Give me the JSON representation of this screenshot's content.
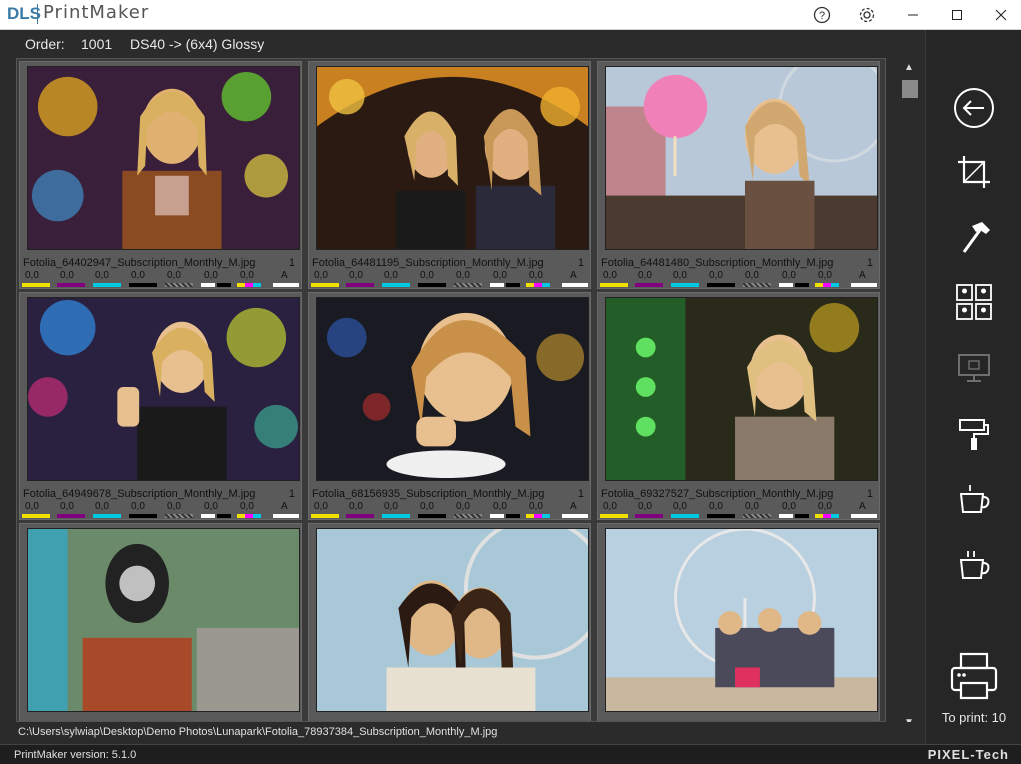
{
  "app": {
    "brand": "DLS",
    "name": "PrintMaker"
  },
  "window_controls": {
    "help_icon": "help-icon",
    "settings_icon": "gear-icon",
    "minimize_icon": "minimize-icon",
    "maximize_icon": "maximize-icon",
    "close_icon": "close-icon"
  },
  "order": {
    "label": "Order:",
    "number": "1001",
    "spec": "DS40 -> (6x4) Glossy"
  },
  "photos": [
    {
      "filename": "Fotolia_64402947_Subscription_Monthly_M.jpg",
      "qty": "1"
    },
    {
      "filename": "Fotolia_64481195_Subscription_Monthly_M.jpg",
      "qty": "1"
    },
    {
      "filename": "Fotolia_64481480_Subscription_Monthly_M.jpg",
      "qty": "1"
    },
    {
      "filename": "Fotolia_64949678_Subscription_Monthly_M.jpg",
      "qty": "1"
    },
    {
      "filename": "Fotolia_68156935_Subscription_Monthly_M.jpg",
      "qty": "1"
    },
    {
      "filename": "Fotolia_69327527_Subscription_Monthly_M.jpg",
      "qty": "1"
    }
  ],
  "correction_values": [
    "0,0",
    "0,0",
    "0,0",
    "0,0",
    "0,0",
    "0,0",
    "0,0",
    "0,0",
    "A"
  ],
  "correction_colors": [
    "#f0e000",
    "#800080",
    "#00c8e0",
    "#000000",
    "#888888",
    "#ffffff",
    "#ff00ff",
    "#ffffff"
  ],
  "scroll": {
    "up_icon": "scroll-up-arrow",
    "down_icon": "scroll-down-arrow"
  },
  "path": "C:\\Users\\sylwiap\\Desktop\\Demo Photos\\Lunapark\\Fotolia_78937384_Subscription_Monthly_M.jpg",
  "status": {
    "version": "PrintMaker version: 5.1.0",
    "brand": "PIXEL-Tech"
  },
  "sidebar": {
    "buttons": [
      "back-arrow-icon",
      "crop-icon",
      "hammer-icon",
      "photo-layout-icon",
      "monitor-print-icon",
      "paint-roller-icon",
      "coffee-cup-icon",
      "coffee-cup-steam-icon"
    ],
    "print_icon": "printer-icon",
    "to_print": "To print: 10"
  }
}
